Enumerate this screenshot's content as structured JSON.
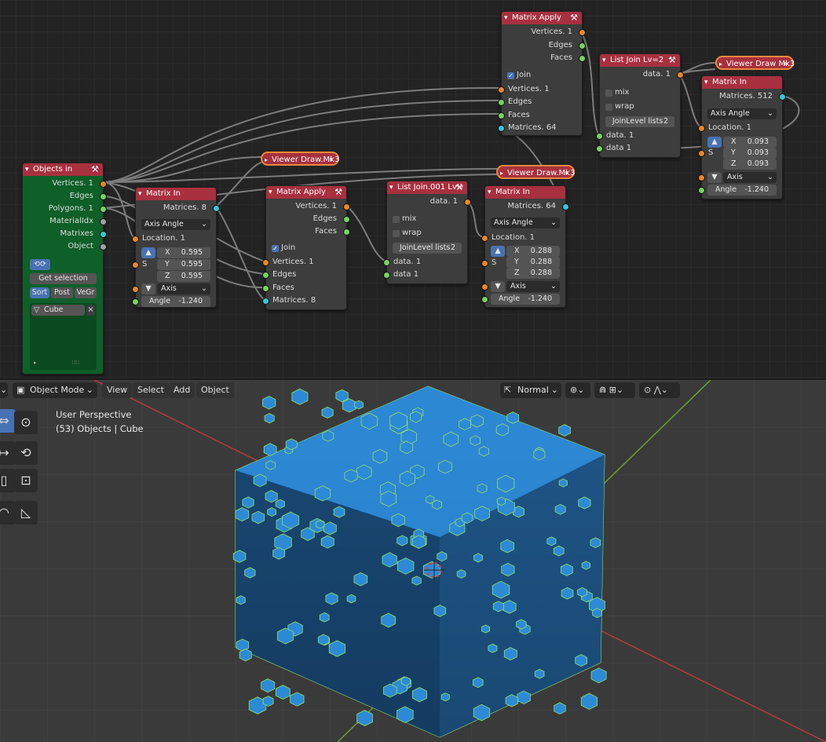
{
  "node_editor": {
    "objects_in": {
      "title": "Objects in",
      "outputs": [
        "Vertices. 1",
        "Edges",
        "Polygons. 1",
        "MaterialIdx",
        "Matrixes",
        "Object"
      ],
      "get_selection": "Get selection",
      "sort_buttons": [
        "Sort",
        "Post",
        "VeGr"
      ],
      "object_item": "Cube"
    },
    "matrix_in_1": {
      "title": "Matrix In",
      "output": "Matrices. 8",
      "mode": "Axis Angle",
      "location": "Location. 1",
      "s_label": "S",
      "x": "0.595",
      "y": "0.595",
      "z": "0.595",
      "axis": "Axis",
      "angle_label": "Angle",
      "angle": "-1.240"
    },
    "matrix_apply_1": {
      "title": "Matrix Apply",
      "outputs": [
        "Vertices. 1",
        "Edges",
        "Faces"
      ],
      "join": "Join",
      "inputs": [
        "Vertices. 1",
        "Edges",
        "Faces",
        "Matrices. 8"
      ]
    },
    "list_join_1": {
      "title": "List Join.001 Lv=",
      "output": "data. 1",
      "mix": "mix",
      "wrap": "wrap",
      "joinlevel_label": "JoinLevel lists",
      "joinlevel": "2",
      "inputs": [
        "data. 1",
        "data 1"
      ]
    },
    "matrix_in_2": {
      "title": "Matrix In",
      "output": "Matrices. 64",
      "mode": "Axis Angle",
      "location": "Location. 1",
      "s_label": "S",
      "x": "0.288",
      "y": "0.288",
      "z": "0.288",
      "axis": "Axis",
      "angle_label": "Angle",
      "angle": "-1.240"
    },
    "matrix_apply_2": {
      "title": "Matrix Apply",
      "outputs": [
        "Vertices. 1",
        "Edges",
        "Faces"
      ],
      "join": "Join",
      "inputs": [
        "Vertices. 1",
        "Edges",
        "Faces",
        "Matrices. 64"
      ]
    },
    "list_join_2": {
      "title": "List Join Lv=2",
      "output": "data. 1",
      "mix": "mix",
      "wrap": "wrap",
      "joinlevel_label": "JoinLevel lists",
      "joinlevel": "2",
      "inputs": [
        "data. 1",
        "data 1"
      ]
    },
    "matrix_in_3": {
      "title": "Matrix In",
      "output": "Matrices. 512",
      "mode": "Axis Angle",
      "location": "Location. 1",
      "s_label": "S",
      "x": "0.093",
      "y": "0.093",
      "z": "0.093",
      "axis": "Axis",
      "angle_label": "Angle",
      "angle": "-1.240"
    },
    "viewers": [
      "Viewer Draw.Mk3",
      "Viewer Draw.Mk3",
      "Viewer Draw Mk3"
    ],
    "x_label": "X",
    "y_label": "Y",
    "z_label": "Z"
  },
  "viewport": {
    "mode": "Object Mode",
    "menus": [
      "View",
      "Select",
      "Add",
      "Object"
    ],
    "orientation": "Normal",
    "perspective": "User Perspective",
    "collection_info": "(53) Objects | Cube",
    "colors": {
      "face": "#2d8ad6",
      "edge": "#8fe06a",
      "x_axis": "#b43c3c",
      "y_axis": "#6aa02e",
      "background": "#3a3a3a"
    }
  }
}
